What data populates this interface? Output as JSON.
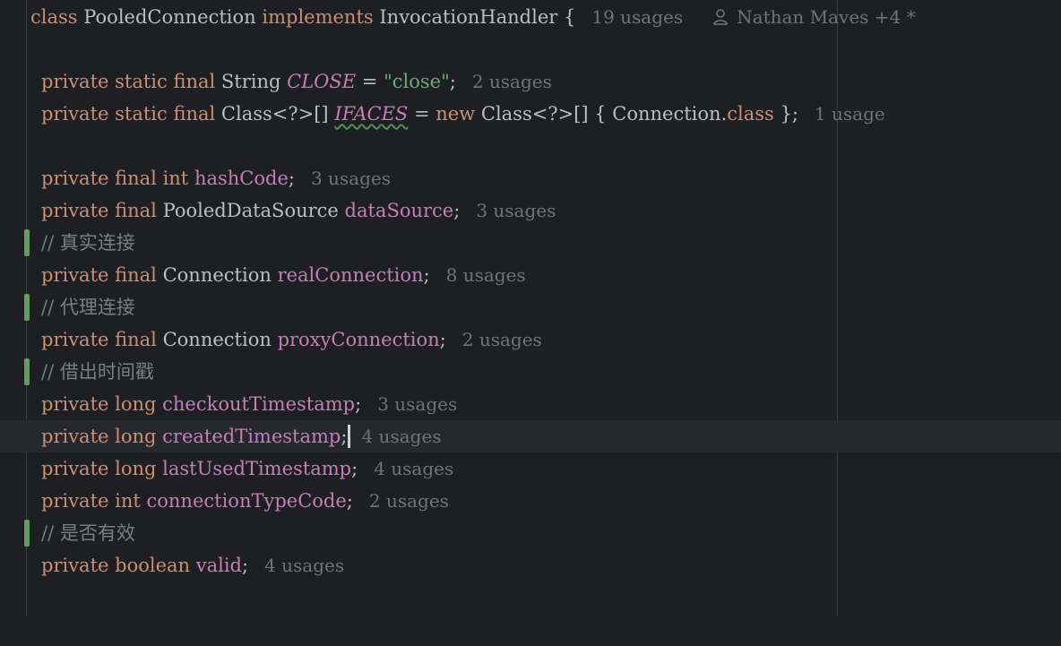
{
  "editor": {
    "header": {
      "kw_class": "class",
      "class_name": "PooledConnection",
      "kw_implements": "implements",
      "interface_name": "InvocationHandler",
      "brace": "{",
      "usages": "19 usages",
      "author": "Nathan Maves +4 *"
    },
    "lines": [
      {
        "kw": "private static final",
        "type": "String",
        "name": "CLOSE",
        "eq": " = ",
        "value": "\"close\"",
        "semi": ";",
        "usages": "2 usages"
      },
      {
        "kw": "private static final",
        "type": "Class<?>[]",
        "name": "IFACES",
        "eq": " = ",
        "kw_new": "new",
        "type2": " Class<?>[] { Connection.",
        "kw_class": "class",
        "end": " };",
        "usages": "1 usage"
      },
      {
        "kw": "private final int",
        "name": "hashCode",
        "semi": ";",
        "usages": "3 usages"
      },
      {
        "kw": "private final",
        "type": "PooledDataSource",
        "name": "dataSource",
        "semi": ";",
        "usages": "3 usages"
      },
      {
        "comment": "// 真实连接"
      },
      {
        "kw": "private final",
        "type": "Connection",
        "name": "realConnection",
        "semi": ";",
        "usages": "8 usages"
      },
      {
        "comment": "// 代理连接"
      },
      {
        "kw": "private final",
        "type": "Connection",
        "name": "proxyConnection",
        "semi": ";",
        "usages": "2 usages"
      },
      {
        "comment": "// 借出时间戳"
      },
      {
        "kw": "private long",
        "name": "checkoutTimestamp",
        "semi": ";",
        "usages": "3 usages"
      },
      {
        "kw": "private long",
        "name": "createdTimestamp",
        "semi": ";",
        "usages": "4 usages"
      },
      {
        "kw": "private long",
        "name": "lastUsedTimestamp",
        "semi": ";",
        "usages": "4 usages"
      },
      {
        "kw": "private int",
        "name": "connectionTypeCode",
        "semi": ";",
        "usages": "2 usages"
      },
      {
        "comment": "// 是否有效"
      },
      {
        "kw": "private boolean",
        "name": "valid",
        "semi": ";",
        "usages": "4 usages"
      }
    ]
  }
}
